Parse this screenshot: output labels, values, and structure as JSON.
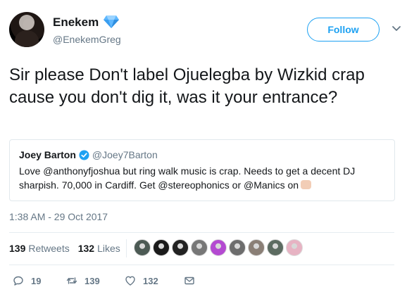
{
  "user": {
    "display_name": "Enekem",
    "handle": "@EnekemGreg",
    "follow_label": "Follow"
  },
  "tweet": {
    "text": "Sir please Don't label Ojuelegba by Wizkid crap cause you don't dig it, was it your entrance?",
    "timestamp": "1:38 AM - 29 Oct 2017"
  },
  "quote": {
    "name": "Joey Barton",
    "handle": "@Joey7Barton",
    "text": "Love @anthonyfjoshua but ring walk music is crap. Needs to get a decent DJ sharpish. 70,000 in Cardiff. Get @stereophonics or @Manics on"
  },
  "stats": {
    "retweets_count": "139",
    "retweets_label": "Retweets",
    "likes_count": "132",
    "likes_label": "Likes"
  },
  "actions": {
    "reply_count": "19",
    "retweet_count": "139",
    "like_count": "132"
  },
  "colors": {
    "accent": "#1da1f2",
    "secondary_text": "#657786",
    "border": "#e1e8ed"
  },
  "liker_avatars": [
    "#4c5a54",
    "#1a1a1a",
    "#222222",
    "#777777",
    "#b44ad1",
    "#6d6d6d",
    "#8a7f76",
    "#5c6b61",
    "#e7b3c3"
  ]
}
